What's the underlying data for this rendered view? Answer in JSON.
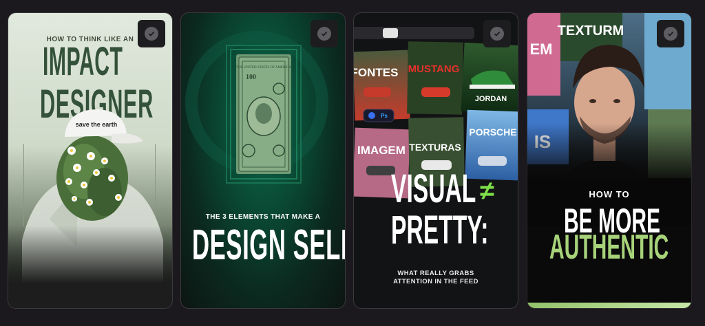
{
  "cards": [
    {
      "kicker": "HOW TO THINK LIKE AN",
      "title_line1": "IMPACT",
      "title_line2": "DESIGNER",
      "cap_text": "save the earth"
    },
    {
      "kicker": "THE 3 ELEMENTS THAT MAKE A",
      "title": "DESIGN SELL",
      "bill_text": "THE UNITED STATES OF AMERICA",
      "bill_value": "100"
    },
    {
      "title_line1": "VISUAL",
      "symbol": "≠",
      "title_line2": "PRETTY:",
      "subtitle_line1": "WHAT REALLY GRABS",
      "subtitle_line2": "ATTENTION IN THE FEED",
      "tiles": [
        "FONTES",
        "MUSTANG",
        "JORDAN",
        "IMAGEM",
        "TEXTURAS",
        "PORSCHE"
      ],
      "app_badge": "Ps"
    },
    {
      "kicker": "HOW TO",
      "title_line1": "BE MORE",
      "title_line2": "AUTHENTIC",
      "poster_text_1": "TEXTURM",
      "poster_text_2": "EM",
      "poster_text_3": "IS"
    }
  ],
  "colors": {
    "page_bg": "#1b191d",
    "accent_green": "#7fe04a",
    "authentic_green": "#a7d37a"
  }
}
